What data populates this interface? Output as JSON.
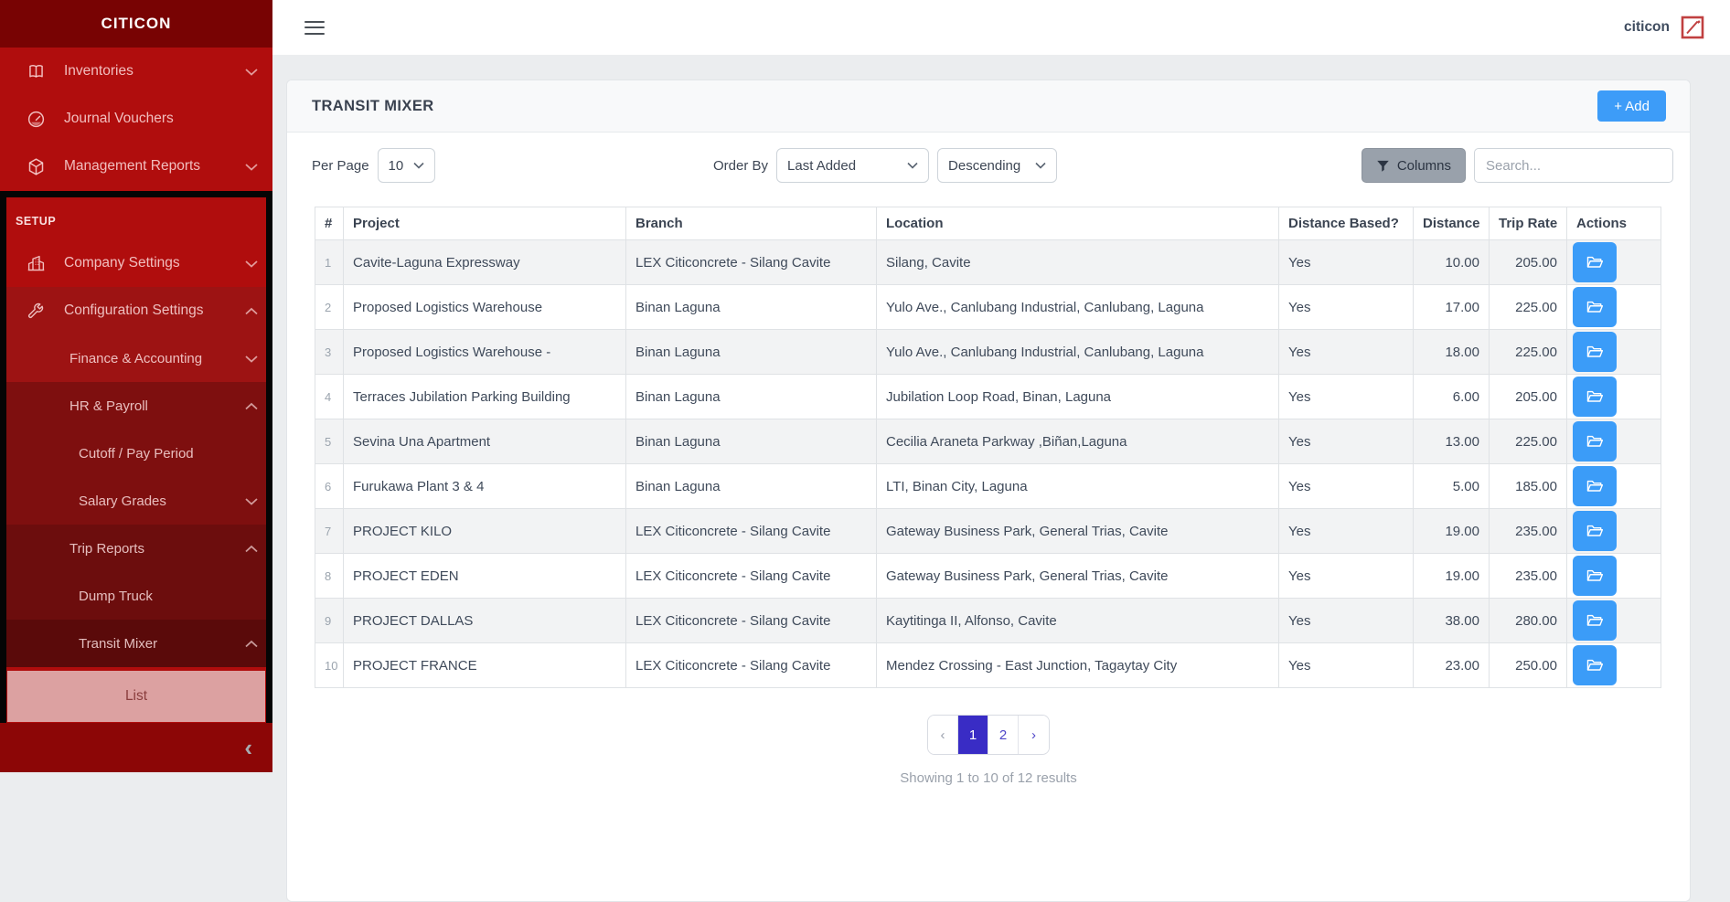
{
  "brand": "CITICON",
  "topbar": {
    "user_label": "citicon"
  },
  "sidebar": {
    "setup_label": "SETUP",
    "collapse_icon": "chevron-left-icon",
    "items": [
      {
        "label": "Inventories",
        "icon": "book-icon",
        "chevron": "down"
      },
      {
        "label": "Journal Vouchers",
        "icon": "gauge-icon",
        "chevron": ""
      },
      {
        "label": "Management Reports",
        "icon": "cube-icon",
        "chevron": "down"
      },
      {
        "label": "Company Settings",
        "icon": "building-icon",
        "chevron": "down"
      },
      {
        "label": "Configuration Settings",
        "icon": "wrench-icon",
        "chevron": "up"
      },
      {
        "label": "Finance & Accounting",
        "icon": "",
        "chevron": "down"
      },
      {
        "label": "HR & Payroll",
        "icon": "",
        "chevron": "up"
      },
      {
        "label": "Cutoff / Pay Period",
        "icon": "",
        "chevron": ""
      },
      {
        "label": "Salary Grades",
        "icon": "",
        "chevron": "down"
      },
      {
        "label": "Trip Reports",
        "icon": "",
        "chevron": "up"
      },
      {
        "label": "Dump Truck",
        "icon": "",
        "chevron": ""
      },
      {
        "label": "Transit Mixer",
        "icon": "",
        "chevron": "up"
      },
      {
        "label": "List",
        "icon": "",
        "chevron": ""
      }
    ]
  },
  "page": {
    "title": "TRANSIT MIXER",
    "add_button": "+ Add"
  },
  "filters": {
    "per_page_label": "Per Page",
    "per_page_value": "10",
    "order_by_label": "Order By",
    "order_by_value": "Last Added",
    "direction_value": "Descending",
    "columns_button": "Columns",
    "search_placeholder": "Search..."
  },
  "table": {
    "headers": [
      "#",
      "Project",
      "Branch",
      "Location",
      "Distance Based?",
      "Distance",
      "Trip Rate",
      "Actions"
    ],
    "rows": [
      {
        "num": "1",
        "project": "Cavite-Laguna Expressway",
        "branch": "LEX Citiconcrete - Silang Cavite",
        "location": "Silang, Cavite",
        "distance_based": "Yes",
        "distance": "10.00",
        "trip_rate": "205.00"
      },
      {
        "num": "2",
        "project": "Proposed Logistics Warehouse",
        "branch": "Binan Laguna",
        "location": "Yulo Ave., Canlubang Industrial, Canlubang, Laguna",
        "distance_based": "Yes",
        "distance": "17.00",
        "trip_rate": "225.00"
      },
      {
        "num": "3",
        "project": "Proposed Logistics Warehouse -",
        "branch": "Binan Laguna",
        "location": "Yulo Ave., Canlubang Industrial, Canlubang, Laguna",
        "distance_based": "Yes",
        "distance": "18.00",
        "trip_rate": "225.00"
      },
      {
        "num": "4",
        "project": "Terraces Jubilation Parking Building",
        "branch": "Binan Laguna",
        "location": "Jubilation Loop Road, Binan, Laguna",
        "distance_based": "Yes",
        "distance": "6.00",
        "trip_rate": "205.00"
      },
      {
        "num": "5",
        "project": "Sevina Una Apartment",
        "branch": "Binan Laguna",
        "location": "Cecilia Araneta Parkway ,Biñan,Laguna",
        "distance_based": "Yes",
        "distance": "13.00",
        "trip_rate": "225.00"
      },
      {
        "num": "6",
        "project": "Furukawa Plant 3 & 4",
        "branch": "Binan Laguna",
        "location": "LTI, Binan City, Laguna",
        "distance_based": "Yes",
        "distance": "5.00",
        "trip_rate": "185.00"
      },
      {
        "num": "7",
        "project": "PROJECT KILO",
        "branch": "LEX Citiconcrete - Silang Cavite",
        "location": "Gateway Business Park, General Trias, Cavite",
        "distance_based": "Yes",
        "distance": "19.00",
        "trip_rate": "235.00"
      },
      {
        "num": "8",
        "project": "PROJECT EDEN",
        "branch": "LEX Citiconcrete - Silang Cavite",
        "location": "Gateway Business Park, General Trias, Cavite",
        "distance_based": "Yes",
        "distance": "19.00",
        "trip_rate": "235.00"
      },
      {
        "num": "9",
        "project": "PROJECT DALLAS",
        "branch": "LEX Citiconcrete - Silang Cavite",
        "location": "Kaytitinga II, Alfonso, Cavite",
        "distance_based": "Yes",
        "distance": "38.00",
        "trip_rate": "280.00"
      },
      {
        "num": "10",
        "project": "PROJECT FRANCE",
        "branch": "LEX Citiconcrete - Silang Cavite",
        "location": "Mendez Crossing - East Junction, Tagaytay City",
        "distance_based": "Yes",
        "distance": "23.00",
        "trip_rate": "250.00"
      }
    ],
    "action_icon": "open-folder-icon"
  },
  "pagination": {
    "prev": "‹",
    "pages": [
      "1",
      "2"
    ],
    "active_page": "1",
    "next": "›",
    "summary": "Showing 1 to 10 of 12 results"
  },
  "colors": {
    "sidebar_red": "#b00d0d",
    "sidebar_header_red": "#780303",
    "active_item_pink": "#dca1a1",
    "accent_blue": "#3d9cf8",
    "pagination_indigo": "#392cc5",
    "annotation_box": "#050505"
  }
}
